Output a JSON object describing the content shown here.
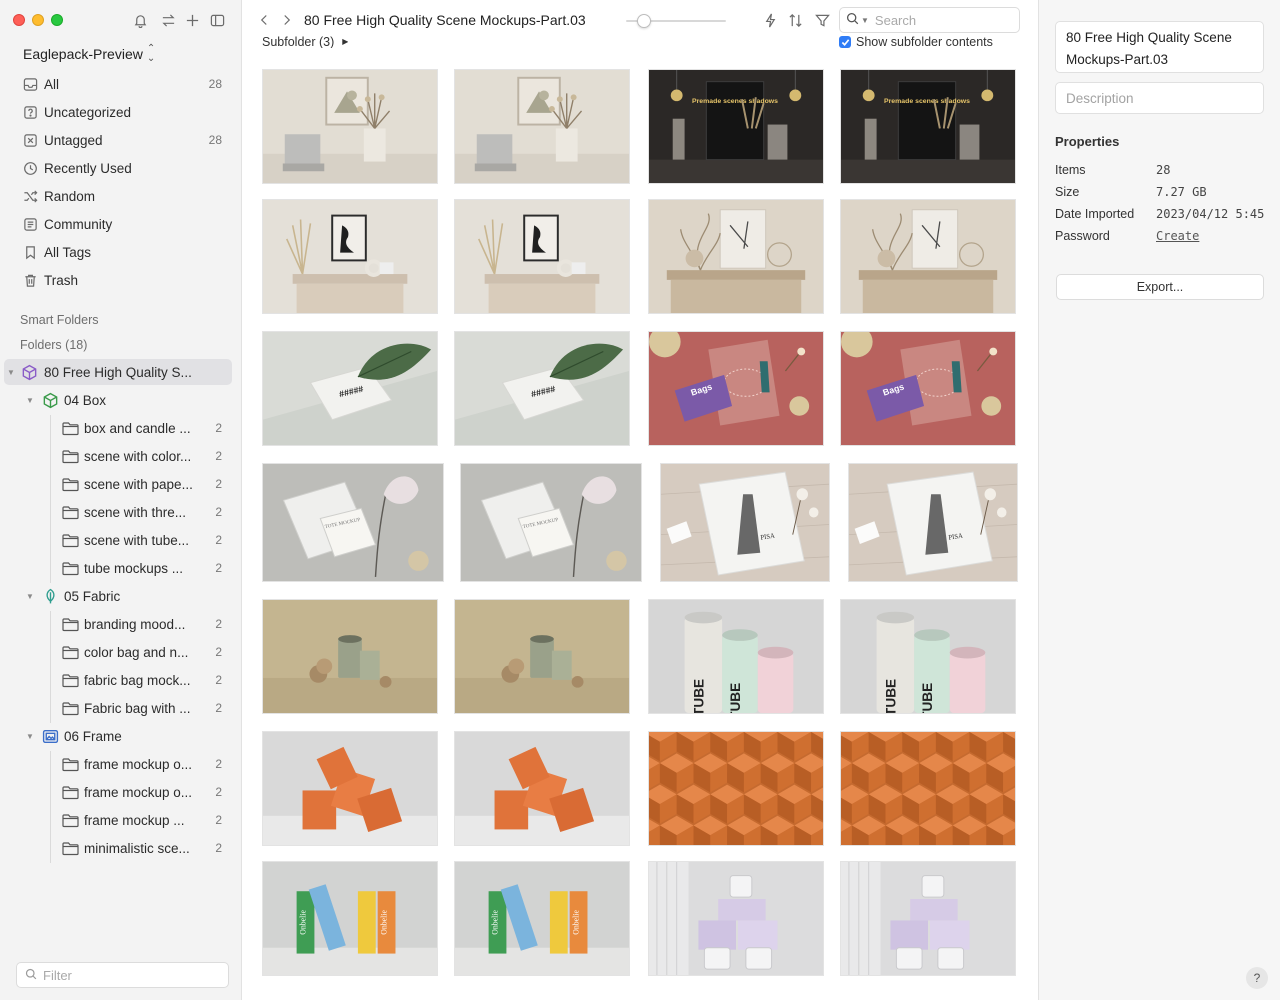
{
  "sidebar": {
    "library_name": "Eaglepack-Preview",
    "nav": [
      {
        "label": "All",
        "count": "28",
        "icon": "inbox-icon"
      },
      {
        "label": "Uncategorized",
        "count": "",
        "icon": "uncategorized-icon"
      },
      {
        "label": "Untagged",
        "count": "28",
        "icon": "untagged-icon"
      },
      {
        "label": "Recently Used",
        "count": "",
        "icon": "clock-icon"
      },
      {
        "label": "Random",
        "count": "",
        "icon": "shuffle-icon"
      },
      {
        "label": "Community",
        "count": "",
        "icon": "community-icon"
      },
      {
        "label": "All Tags",
        "count": "",
        "icon": "bookmark-icon"
      },
      {
        "label": "Trash",
        "count": "",
        "icon": "trash-icon"
      }
    ],
    "smart_folders_title": "Smart Folders",
    "folders_title": "Folders (18)",
    "tree": [
      {
        "label": "80 Free High Quality S...",
        "count": "",
        "level": 0,
        "kind": "cube",
        "expanded": true,
        "selected": true
      },
      {
        "label": "04 Box",
        "count": "",
        "level": 1,
        "kind": "box",
        "expanded": true
      },
      {
        "label": "box and candle ...",
        "count": "2",
        "level": 2,
        "kind": "folder"
      },
      {
        "label": "scene with color...",
        "count": "2",
        "level": 2,
        "kind": "folder"
      },
      {
        "label": "scene with pape...",
        "count": "2",
        "level": 2,
        "kind": "folder"
      },
      {
        "label": "scene with thre...",
        "count": "2",
        "level": 2,
        "kind": "folder"
      },
      {
        "label": "scene with tube...",
        "count": "2",
        "level": 2,
        "kind": "folder"
      },
      {
        "label": "tube mockups ...",
        "count": "2",
        "level": 2,
        "kind": "folder"
      },
      {
        "label": "05 Fabric",
        "count": "",
        "level": 1,
        "kind": "leaf",
        "expanded": true
      },
      {
        "label": "branding mood...",
        "count": "2",
        "level": 2,
        "kind": "folder"
      },
      {
        "label": "color bag and n...",
        "count": "2",
        "level": 2,
        "kind": "folder"
      },
      {
        "label": "fabric bag mock...",
        "count": "2",
        "level": 2,
        "kind": "folder"
      },
      {
        "label": "Fabric bag with ...",
        "count": "2",
        "level": 2,
        "kind": "folder"
      },
      {
        "label": "06 Frame",
        "count": "",
        "level": 1,
        "kind": "frame",
        "expanded": true
      },
      {
        "label": "frame mockup o...",
        "count": "2",
        "level": 2,
        "kind": "folder"
      },
      {
        "label": "frame mockup o...",
        "count": "2",
        "level": 2,
        "kind": "folder"
      },
      {
        "label": "frame mockup ...",
        "count": "2",
        "level": 2,
        "kind": "folder"
      },
      {
        "label": "minimalistic sce...",
        "count": "2",
        "level": 2,
        "kind": "folder"
      }
    ],
    "filter_placeholder": "Filter"
  },
  "main": {
    "title": "80 Free High Quality Scene Mockups-Part.03",
    "zoom_level": 0.13,
    "search_placeholder": "Search",
    "subfolder_label": "Subfolder (3)",
    "show_subfolder_label": "Show subfolder contents",
    "show_subfolder_checked": true,
    "thumbnails": [
      {
        "scene": "frame-wall",
        "bg": "#e2ddd3"
      },
      {
        "scene": "frame-wall",
        "bg": "#e2ddd3"
      },
      {
        "scene": "dark-poster",
        "bg": "#2b2826",
        "poster_text": "Premade scenes shadows"
      },
      {
        "scene": "dark-poster",
        "bg": "#2b2826",
        "poster_text": "Premade scenes shadows"
      },
      {
        "scene": "frame-console",
        "bg": "#e4e0d8"
      },
      {
        "scene": "frame-console",
        "bg": "#e4e0d8"
      },
      {
        "scene": "frame-console-beige",
        "bg": "#ddd5c8"
      },
      {
        "scene": "frame-console-beige",
        "bg": "#ddd5c8"
      },
      {
        "scene": "leaf-bag",
        "bg": "#d9dbd6"
      },
      {
        "scene": "leaf-bag",
        "bg": "#d9dbd6"
      },
      {
        "scene": "red-bag",
        "bg": "#b8625e",
        "bag_text": "Bags"
      },
      {
        "scene": "red-bag",
        "bg": "#b8625e",
        "bag_text": "Bags"
      },
      {
        "scene": "flower-bag",
        "bg": "#bdbdb9",
        "bag_text": "TOTE MOCKUP"
      },
      {
        "scene": "flower-bag",
        "bg": "#bdbdb9",
        "bag_text": "TOTE MOCKUP"
      },
      {
        "scene": "pisa-towel",
        "bg": "#d6cbc0",
        "towel_text": "PISA"
      },
      {
        "scene": "pisa-towel",
        "bg": "#d6cbc0",
        "towel_text": "PISA"
      },
      {
        "scene": "tin-can",
        "bg": "#c4b590"
      },
      {
        "scene": "tin-can",
        "bg": "#c4b590"
      },
      {
        "scene": "tubes",
        "bg": "#d6d6d6",
        "tube_text": "TUBE"
      },
      {
        "scene": "tubes",
        "bg": "#d6d6d6",
        "tube_text": "TUBE"
      },
      {
        "scene": "orange-boxes",
        "bg": "#d9d9d9"
      },
      {
        "scene": "orange-boxes",
        "bg": "#d9d9d9"
      },
      {
        "scene": "box-pattern",
        "bg": "#c56a2f"
      },
      {
        "scene": "box-pattern",
        "bg": "#c56a2f"
      },
      {
        "scene": "color-boxes",
        "bg": "#d2d3d2",
        "box_text": "Onbelie"
      },
      {
        "scene": "color-boxes",
        "bg": "#d2d3d2",
        "box_text": "Onbelie"
      },
      {
        "scene": "candles",
        "bg": "#dcdcdd"
      },
      {
        "scene": "candles",
        "bg": "#dcdcdd"
      }
    ]
  },
  "inspector": {
    "name": "80 Free High Quality Scene Mockups-Part.03",
    "description_placeholder": "Description",
    "properties_title": "Properties",
    "properties": [
      {
        "key": "Items",
        "value": "28"
      },
      {
        "key": "Size",
        "value": "7.27 GB"
      },
      {
        "key": "Date Imported",
        "value": "2023/04/12 5:45"
      },
      {
        "key": "Password",
        "value": "Create",
        "link": true
      }
    ],
    "export_label": "Export...",
    "help_label": "?"
  },
  "colors": {
    "accent": "#2f7cf6",
    "sidebar_bg": "#f3f3f3",
    "selected_bg": "#e1e1e4",
    "box_icon": "#3a9a4a",
    "leaf_icon": "#2f9e8f",
    "frame_icon": "#3b6ec9",
    "cube_icon": "#8a5cc7"
  }
}
